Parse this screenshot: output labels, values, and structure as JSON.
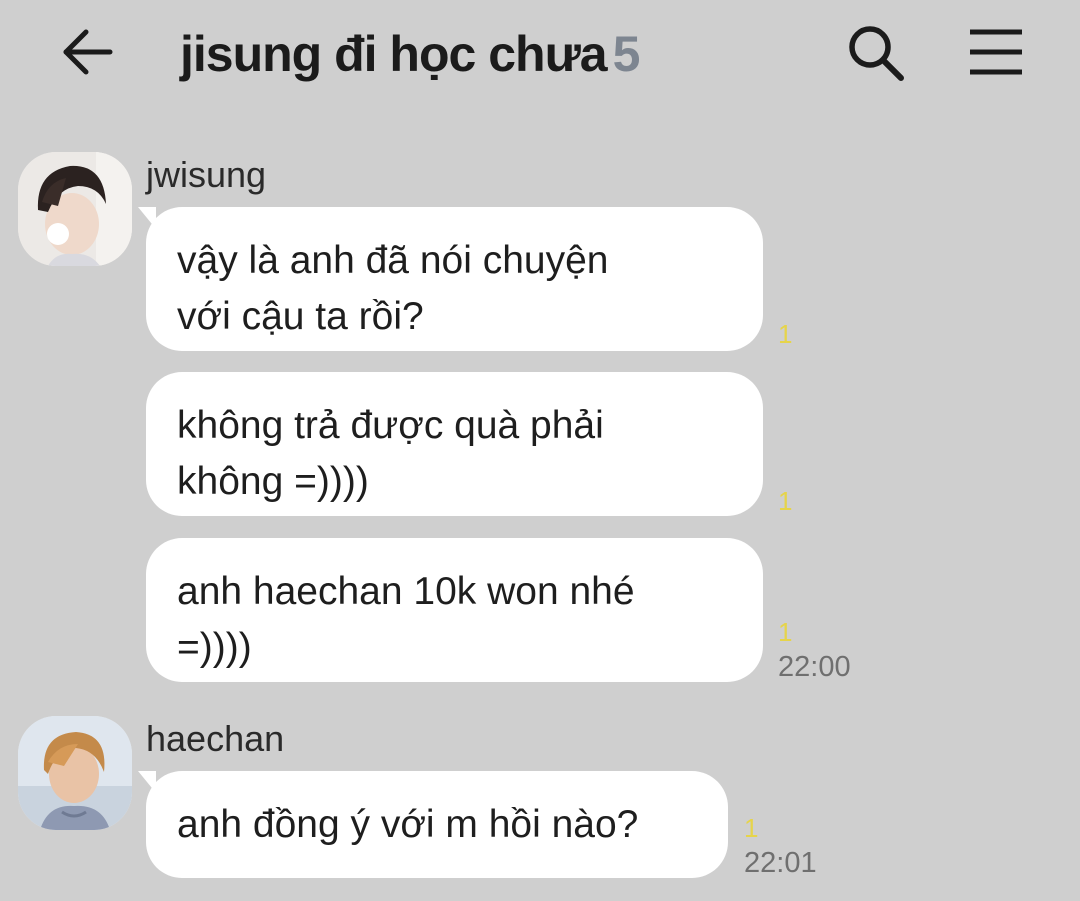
{
  "header": {
    "title": "jisung đi học chưa",
    "member_count": "5",
    "back_icon": "arrow-left-icon",
    "search_icon": "search-icon",
    "menu_icon": "hamburger-menu-icon"
  },
  "messages": [
    {
      "sender": "jwisung",
      "bubbles": [
        {
          "lines": [
            "vậy là anh đã nói chuyện",
            "với cậu ta rồi?"
          ],
          "unread": "1"
        },
        {
          "lines": [
            "không trả được quà phải",
            "không =))))"
          ],
          "unread": "1"
        },
        {
          "lines": [
            "anh haechan 10k won nhé",
            "=))))"
          ],
          "unread": "1",
          "time": "22:00"
        }
      ]
    },
    {
      "sender": "haechan",
      "bubbles": [
        {
          "lines": [
            "anh đồng ý với m hồi nào?"
          ],
          "unread": "1",
          "time": "22:01"
        }
      ]
    }
  ],
  "colors": {
    "background": "#cfcfcf",
    "bubble": "#ffffff",
    "unread": "#e6d44a",
    "count": "#7d8590"
  }
}
